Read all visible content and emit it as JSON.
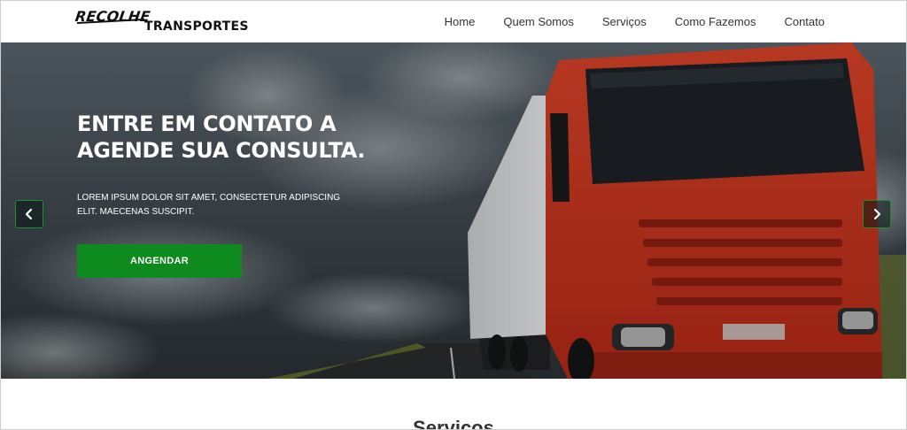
{
  "brand": {
    "line1": "RECOLHE",
    "line2": "TRANSPORTES"
  },
  "nav": {
    "items": [
      "Home",
      "Quem Somos",
      "Serviços",
      "Como Fazemos",
      "Contato"
    ]
  },
  "hero": {
    "title": "ENTRE EM CONTATO A AGENDE SUA CONSULTA.",
    "text": "LOREM IPSUM DOLOR SIT AMET, CONSECTETUR ADIPISCING ELIT. MAECENAS SUSCIPIT.",
    "button_label": "ANGENDAR",
    "prev_icon": "chevron-left-icon",
    "next_icon": "chevron-right-icon"
  },
  "services": {
    "heading": "Serviços"
  },
  "colors": {
    "accent": "#0f8a1e",
    "truck": "#d8361f",
    "header_bg": "#ffffff"
  }
}
